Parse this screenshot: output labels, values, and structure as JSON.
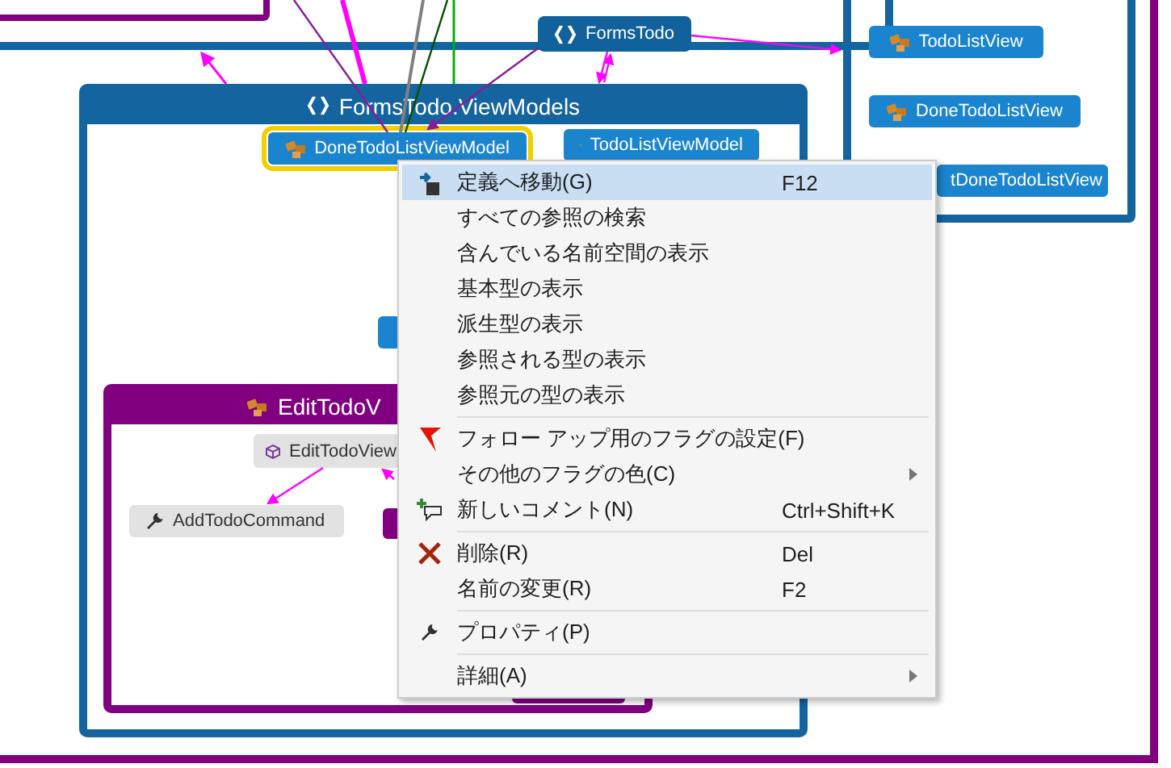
{
  "groups": [
    {
      "title": "FormsTodo.ViewModels",
      "kind": "namespace"
    },
    {
      "title": "EditTodoV",
      "kind": "class"
    }
  ],
  "nodes": [
    {
      "label": "FormsTodo",
      "kind": "namespace",
      "selected": false
    },
    {
      "label": "TodoListView",
      "kind": "class",
      "selected": false
    },
    {
      "label": "DoneTodoListView",
      "kind": "class",
      "selected": false
    },
    {
      "label": "tDoneTodoListView",
      "kind": "class",
      "selected": false
    },
    {
      "label": "DoneTodoListViewModel",
      "kind": "class",
      "selected": true
    },
    {
      "label": "TodoListViewModel",
      "kind": "class",
      "selected": false
    },
    {
      "label": "EditTodoView",
      "kind": "member",
      "selected": false
    },
    {
      "label": "AddTodoCommand",
      "kind": "command",
      "selected": false
    }
  ],
  "context_menu": {
    "sections": [
      {
        "items": [
          {
            "label": "定義へ移動(G)",
            "shortcut": "F12",
            "selected": true,
            "has_submenu": false
          },
          {
            "label": "すべての参照の検索",
            "selected": false,
            "has_submenu": false
          },
          {
            "label": "含んでいる名前空間の表示",
            "selected": false,
            "has_submenu": false
          },
          {
            "label": "基本型の表示",
            "selected": false,
            "has_submenu": false
          },
          {
            "label": "派生型の表示",
            "selected": false,
            "has_submenu": false
          },
          {
            "label": "参照される型の表示",
            "selected": false,
            "has_submenu": false
          },
          {
            "label": "参照元の型の表示",
            "selected": false,
            "has_submenu": false
          }
        ]
      },
      {
        "items": [
          {
            "label": "フォロー アップ用のフラグの設定(F)",
            "selected": false,
            "has_submenu": false
          },
          {
            "label": "その他のフラグの色(C)",
            "selected": false,
            "has_submenu": true
          },
          {
            "label": "新しいコメント(N)",
            "shortcut": "Ctrl+Shift+K",
            "selected": false,
            "has_submenu": false
          }
        ]
      },
      {
        "items": [
          {
            "label": "削除(R)",
            "shortcut": "Del",
            "selected": false,
            "has_submenu": false
          },
          {
            "label": "名前の変更(R)",
            "shortcut": "F2",
            "selected": false,
            "has_submenu": false
          }
        ]
      },
      {
        "items": [
          {
            "label": "プロパティ(P)",
            "selected": false,
            "has_submenu": false
          }
        ]
      },
      {
        "items": [
          {
            "label": "詳細(A)",
            "selected": false,
            "has_submenu": true
          }
        ]
      }
    ]
  }
}
